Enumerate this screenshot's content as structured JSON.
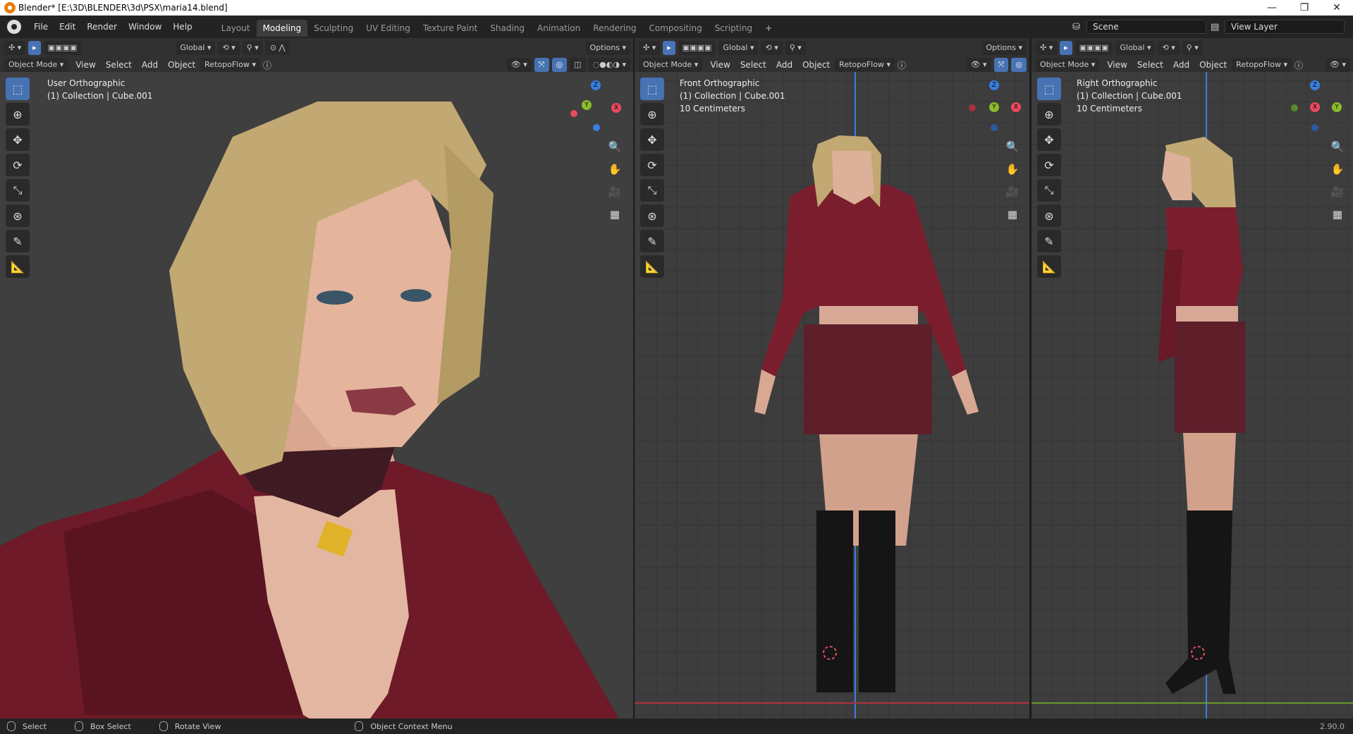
{
  "window": {
    "title": "Blender* [E:\\3D\\BLENDER\\3d\\PSX\\maria14.blend]",
    "minimize": "—",
    "restore": "❐",
    "close": "✕"
  },
  "menu": [
    "File",
    "Edit",
    "Render",
    "Window",
    "Help"
  ],
  "workspaces": [
    {
      "label": "Layout"
    },
    {
      "label": "Modeling",
      "active": true
    },
    {
      "label": "Sculpting"
    },
    {
      "label": "UV Editing"
    },
    {
      "label": "Texture Paint"
    },
    {
      "label": "Shading"
    },
    {
      "label": "Animation"
    },
    {
      "label": "Rendering"
    },
    {
      "label": "Compositing"
    },
    {
      "label": "Scripting"
    }
  ],
  "add_workspace": "+",
  "scene": {
    "label": "Scene",
    "view_layer": "View Layer"
  },
  "viewports": [
    {
      "transform": "Global",
      "options": "Options",
      "mode": "Object Mode",
      "menus": [
        "View",
        "Select",
        "Add",
        "Object"
      ],
      "addon": "RetopoFlow",
      "view_name": "User Orthographic",
      "collection": "(1) Collection | Cube.001",
      "scale_text": ""
    },
    {
      "transform": "Global",
      "options": "Options",
      "mode": "Object Mode",
      "menus": [
        "View",
        "Select",
        "Add",
        "Object"
      ],
      "addon": "RetopoFlow",
      "view_name": "Front Orthographic",
      "collection": "(1) Collection | Cube.001",
      "scale_text": "10 Centimeters"
    },
    {
      "transform": "Global",
      "options": "",
      "mode": "Object Mode",
      "menus": [
        "View",
        "Select",
        "Add",
        "Object"
      ],
      "addon": "RetopoFlow",
      "view_name": "Right Orthographic",
      "collection": "(1) Collection | Cube.001",
      "scale_text": "10 Centimeters"
    }
  ],
  "tools": [
    "select-box-icon",
    "cursor-icon",
    "move-icon",
    "rotate-icon",
    "scale-icon",
    "transform-icon",
    "annotate-icon",
    "measure-icon"
  ],
  "status": {
    "select": "Select",
    "box_select": "Box Select",
    "rotate_view": "Rotate View",
    "context_menu": "Object Context Menu",
    "version": "2.90.0"
  },
  "colors": {
    "accent": "#4772b3",
    "x_axis": "#e84a5f",
    "y_axis": "#8bbd2b",
    "z_axis": "#3a7ee0",
    "jacket": "#7a1e2e",
    "hair": "#c2a872"
  }
}
